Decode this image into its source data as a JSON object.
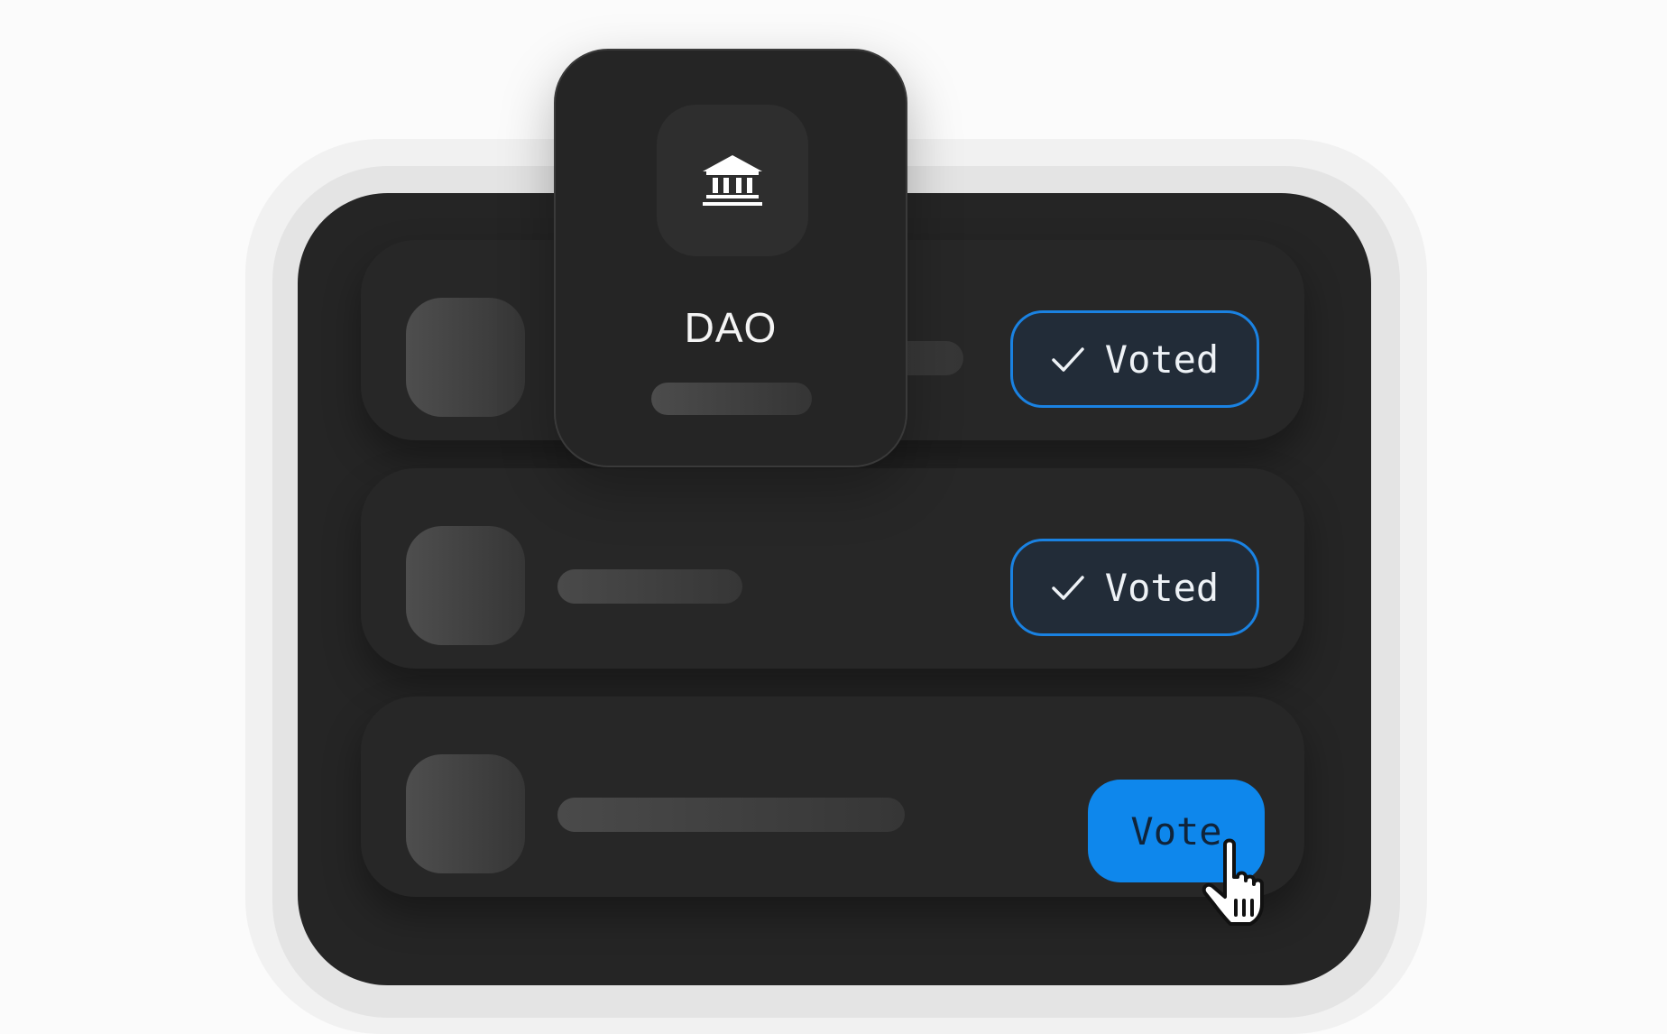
{
  "rows": [
    {
      "button": {
        "label": "Voted",
        "state": "voted",
        "icon": "check-icon"
      }
    },
    {
      "button": {
        "label": "Voted",
        "state": "voted",
        "icon": "check-icon"
      }
    },
    {
      "button": {
        "label": "Vote",
        "state": "active"
      }
    }
  ],
  "dao_card": {
    "title": "DAO",
    "icon": "bank-building-icon"
  },
  "cursor": {
    "icon": "pointer-hand-icon"
  },
  "colors": {
    "accent": "#0e87ec",
    "voted_border": "#1a82e2",
    "panel": "#252525",
    "background": "#fbfbfb"
  }
}
